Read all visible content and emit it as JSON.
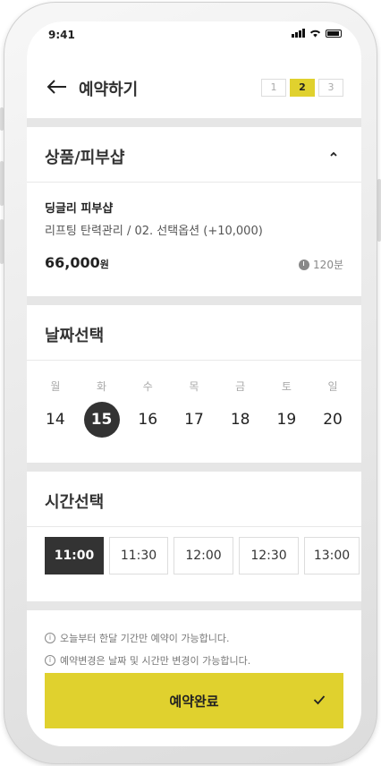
{
  "status": {
    "time": "9:41"
  },
  "header": {
    "title": "예약하기",
    "steps": [
      "1",
      "2",
      "3"
    ],
    "active_step": "2"
  },
  "product_section": {
    "title": "상품/피부샵",
    "name": "딩글리 피부샵",
    "option": "리프팅 탄력관리 / 02. 선택옵션 (+10,000)",
    "price": "66,000",
    "price_unit": "원",
    "duration": "120분"
  },
  "date_section": {
    "title": "날짜선택",
    "weekdays": [
      "월",
      "화",
      "수",
      "목",
      "금",
      "토",
      "일"
    ],
    "dates": [
      "14",
      "15",
      "16",
      "17",
      "18",
      "19",
      "20"
    ],
    "selected_date": "15"
  },
  "time_section": {
    "title": "시간선택",
    "times": [
      "11:00",
      "11:30",
      "12:00",
      "12:30",
      "13:00"
    ],
    "selected_time": "11:00"
  },
  "notes": [
    "오늘부터 한달 기간만 예약이 가능합니다.",
    "예약변경은 날짜 및 시간만 변경이 가능합니다."
  ],
  "confirm_label": "예약완료",
  "colors": {
    "accent": "#e0d12e",
    "dark": "#333333"
  }
}
